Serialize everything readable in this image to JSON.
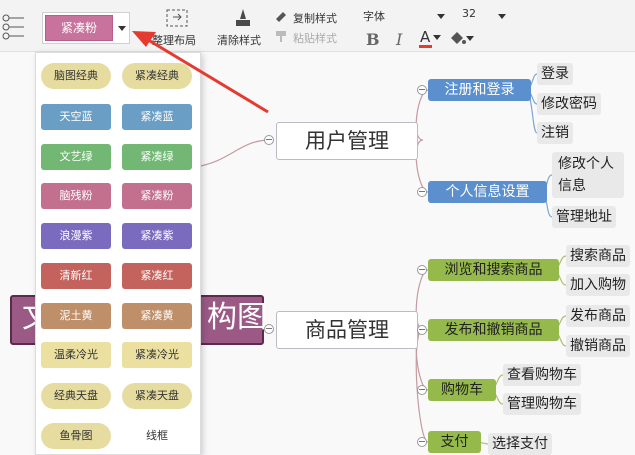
{
  "toolbar": {
    "theme_selected": "紧凑粉",
    "organize_label": "整理布局",
    "clear_style_label": "清除样式",
    "copy_style_label": "复制样式",
    "paste_style_label": "粘贴样式",
    "font_label": "字体",
    "font_size": "32",
    "bold": "B",
    "italic": "I",
    "font_color": "A"
  },
  "themes": [
    {
      "left": "脑图经典",
      "right": "紧凑经典"
    },
    {
      "left": "天空蓝",
      "right": "紧凑蓝"
    },
    {
      "left": "文艺绿",
      "right": "紧凑绿"
    },
    {
      "left": "脑残粉",
      "right": "紧凑粉"
    },
    {
      "left": "浪漫紫",
      "right": "紧凑紫"
    },
    {
      "left": "清新红",
      "right": "紧凑红"
    },
    {
      "left": "泥土黄",
      "right": "紧凑黄"
    },
    {
      "left": "温柔冷光",
      "right": "紧凑冷光"
    },
    {
      "left": "经典天盘",
      "right": "紧凑天盘"
    },
    {
      "left": "鱼骨图",
      "right": "线框"
    }
  ],
  "mindmap": {
    "root_partial_left": "文",
    "root_partial_right": "构图",
    "user_mgmt": "用户管理",
    "register_login": "注册和登录",
    "login": "登录",
    "change_password": "修改密码",
    "logout": "注销",
    "personal_info": "个人信息设置",
    "modify_personal_info": "修改个人信息",
    "manage_address": "管理地址",
    "product_mgmt": "商品管理",
    "browse_search": "浏览和搜索商品",
    "search_product": "搜索商品",
    "add_to_cart": "加入购物",
    "publish_revoke": "发布和撤销商品",
    "publish_product": "发布商品",
    "revoke_product": "撤销商品",
    "cart": "购物车",
    "view_cart": "查看购物车",
    "manage_cart": "管理购物车",
    "payment": "支付",
    "choose_payment": "选择支付"
  },
  "colors": {
    "pink_selected": "#c7739d",
    "arrow": "#e53a2f",
    "blue_topic": "#5b8fce",
    "green_topic": "#95b94a"
  }
}
